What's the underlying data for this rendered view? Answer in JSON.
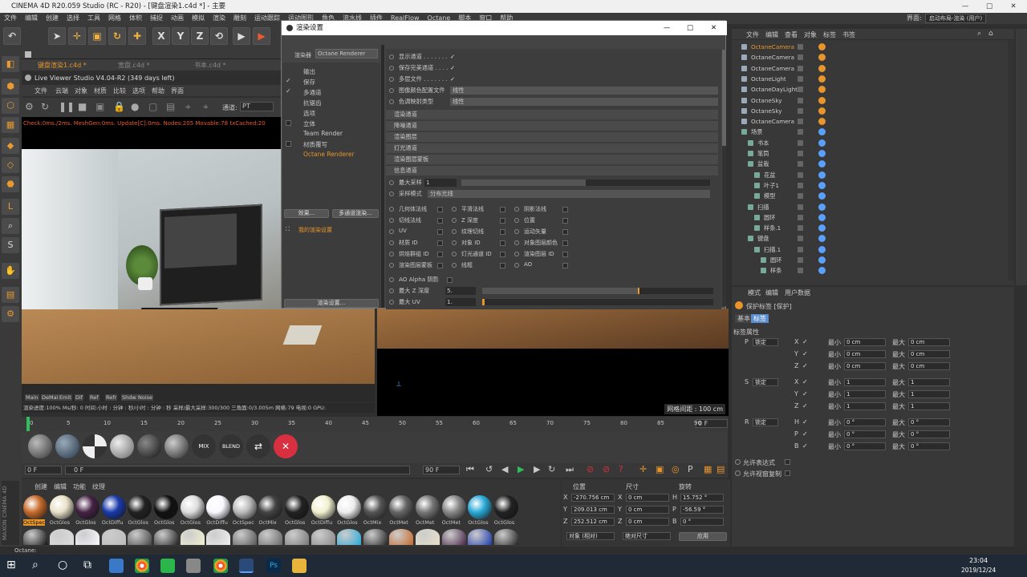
{
  "app": {
    "title": "CINEMA 4D R20.059 Studio (RC - R20) - [键盘渲染1.c4d *] - 主要",
    "min": "—",
    "max": "□",
    "close": "✕"
  },
  "menu": [
    "文件",
    "编辑",
    "创建",
    "选择",
    "工具",
    "网格",
    "体积",
    "捕捉",
    "动画",
    "模拟",
    "渲染",
    "雕刻",
    "运动跟踪",
    "运动图形",
    "角色",
    "流水线",
    "插件",
    "RealFlow",
    "Octane",
    "脚本",
    "窗口",
    "帮助"
  ],
  "layout": {
    "label": "界面:",
    "value": "启动布局-渲染 (用户)"
  },
  "toolbar": {
    "x": "X",
    "y": "Y",
    "z": "Z"
  },
  "tabs": [
    {
      "label": "键盘渲染1.c4d *"
    },
    {
      "label": "宽盘.c4d *"
    },
    {
      "label": "书本.c4d *"
    }
  ],
  "live_viewer": {
    "title": "Live Viewer Studio V4.04-R2 (349 days left)",
    "menu": [
      "文件",
      "云端",
      "对象",
      "材质",
      "比较",
      "选项",
      "帮助",
      "界面"
    ],
    "channel_label": "通道:",
    "channel_value": "PT",
    "status": "Check:0ms./2ms. MeshGen:0ms. Update[C]:0ms. Nodes:205 Movable:78 txCached:20",
    "bottom_tabs": [
      "Main",
      "DeMain",
      "Emit",
      "Dif",
      "Ref",
      "Refr",
      "Shdw",
      "Noise"
    ],
    "progress": "渲染进度:100%  Ms/秒: 0  时间:小时 : 分钟 : 秒/小时 : 分钟 : 秒  采样/最大采样:300/300  三角面:0/3.005m  网格:79  电视:0  GPU:"
  },
  "dialog": {
    "title": "渲染设置",
    "renderer_label": "渲染器",
    "renderer_value": "Octane Renderer",
    "left_items": [
      "输出",
      "保存",
      "多通道",
      "抗锯齿",
      "选项",
      "立体",
      "Team Render",
      "材质覆写",
      "Octane Renderer"
    ],
    "effect_btn": "效果...",
    "multipass_btn": "多通道渲染...",
    "my_setting": "我的渲染设置",
    "render_setting_btn": "渲染设置...",
    "right_rows": [
      {
        "label": "显示通道 . . . . . . ."
      },
      {
        "label": "保存完美通道 . . . ."
      },
      {
        "label": "多层文件 . . . . . . ."
      },
      {
        "label": "图像颜色配置文件",
        "value": "线性"
      },
      {
        "label": "色调映射类型",
        "value": "线性"
      }
    ],
    "sections": [
      "渲染通道",
      "降噪通道",
      "渲染图层",
      "灯光通道",
      "渲染图层蒙板",
      "信息通道"
    ],
    "max_samples_label": "最大采样",
    "max_samples_value": "1",
    "sample_mode_label": "采样模式",
    "sample_mode_value": "分布光线",
    "info_checks": [
      [
        "几何体法线",
        "平滑法线",
        "阴影法线"
      ],
      [
        "切线法线",
        "Z 深度",
        "位置"
      ],
      [
        "UV",
        "纹理切线",
        "运动矢量"
      ],
      [
        "材质 ID",
        "对象 ID",
        "对象图层颜色"
      ],
      [
        "烘焙群组 ID",
        "灯光通道 ID",
        "渲染图层 ID"
      ],
      [
        "渲染图层蒙板",
        "线框",
        "AO"
      ]
    ],
    "ao_alpha": "AO Alpha 阴影",
    "max_z_label": "最大 Z 深度",
    "max_z_value": "5.",
    "max_uv_label": "最大 UV",
    "max_uv_value": "1."
  },
  "objects": {
    "menu": [
      "文件",
      "编辑",
      "查看",
      "对象",
      "标签",
      "书签"
    ],
    "items": [
      "OctaneCamera",
      "OctaneCamera",
      "OctaneCamera",
      "OctaneLight",
      "OctaneDayLight",
      "OctaneSky",
      "OctaneSky",
      "OctaneCamera",
      "场景",
      "书本",
      "笔筒",
      "盆栽",
      "花盆",
      "叶子1",
      "模型",
      "扫描",
      "圆环",
      "样条.1",
      "键盘",
      "扫描.1",
      "圆环",
      "样条"
    ]
  },
  "attributes": {
    "menu": [
      "模式",
      "编辑",
      "用户数据"
    ],
    "title": "保护标签 [保护]",
    "tab_basic": "基本",
    "tab_tag": "标签",
    "section": "标签属性",
    "groups": [
      {
        "key": "P",
        "lock": "锁定",
        "axes": [
          "X",
          "Y",
          "Z"
        ],
        "min": "0 cm",
        "max": "0 cm"
      },
      {
        "key": "S",
        "lock": "锁定",
        "axes": [
          "X",
          "Y",
          "Z"
        ],
        "min": "1",
        "max": "1"
      },
      {
        "key": "R",
        "lock": "锁定",
        "axes": [
          "H",
          "P",
          "B"
        ],
        "min": "0 °",
        "max": "0 °"
      }
    ],
    "min_label": "最小",
    "max_label": "最大",
    "opt1": "允许表达式",
    "opt2": "允许视窗复制"
  },
  "viewport": {
    "grid": "网格间距 : 100 cm"
  },
  "timeline": {
    "ticks": [
      "0",
      "5",
      "10",
      "15",
      "20",
      "25",
      "30",
      "35",
      "40",
      "45",
      "50",
      "55",
      "60",
      "65",
      "70",
      "75",
      "80",
      "85",
      "90"
    ],
    "frame": "0 F"
  },
  "materials_top": [
    "",
    "",
    "",
    "",
    "",
    "",
    "",
    "MIX",
    "BLEND",
    "",
    ""
  ],
  "playback": {
    "start": "0 F",
    "cur": "0 F",
    "end": "90 F",
    "end2": "90 F"
  },
  "matmgr": {
    "menu": [
      "创建",
      "编辑",
      "功能",
      "纹理"
    ],
    "names": [
      "OctSpec",
      "OctGlos",
      "OctGlos",
      "OctDiffu",
      "OctGlos",
      "OctGlos",
      "OctGlos",
      "OctDiffu",
      "OctSpec",
      "OctMix",
      "OctGlos",
      "OctDiffu",
      "OctGlos",
      "OctMix",
      "OctMet",
      "OctMet",
      "OctMet",
      "OctGlos",
      "OctGlos"
    ]
  },
  "coords": {
    "headers": [
      "位置",
      "尺寸",
      "旋转"
    ],
    "rows": [
      [
        "X",
        "-270.756 cm",
        "X",
        "0 cm",
        "H",
        "15.752 °"
      ],
      [
        "Y",
        "209.013 cm",
        "Y",
        "0 cm",
        "P",
        "-56.59 °"
      ],
      [
        "Z",
        "252.512 cm",
        "Z",
        "0 cm",
        "B",
        "0 °"
      ]
    ],
    "mode1": "对象 (相对)",
    "mode2": "绝对尺寸",
    "apply": "应用"
  },
  "status": "Octane:",
  "clock": {
    "time": "23:04",
    "date": "2019/12/24"
  },
  "colors": {
    "accent": "#e8952c",
    "select": "#5aa0ff"
  }
}
